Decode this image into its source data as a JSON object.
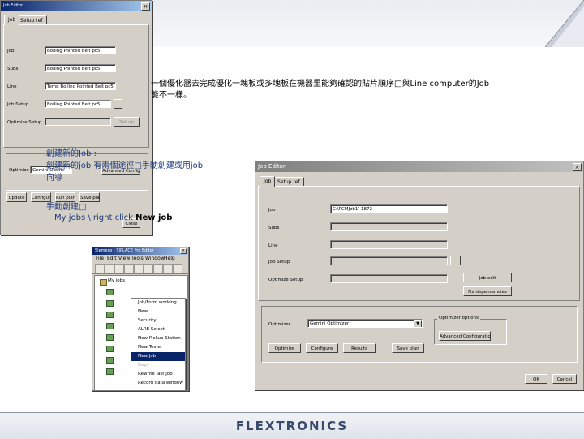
{
  "slide": {
    "intro_line1": "一個優化器去完成優化一塊板或多塊板在機器里能夠確認的貼片順序",
    "intro_line1_tail": "與Line computer的Job",
    "intro_line2": "能不一樣。",
    "heading_create": "創建新的Job :",
    "methods_line": "創建新的job 有兩個途徑",
    "methods_tail": "手動創建或用job",
    "methods_line2": "向導",
    "manual_heading": "手動創建",
    "path_text": "My jobs \\ right click ",
    "path_bold": "New job",
    "logo": "FLEXTRONICS"
  },
  "left_dialog": {
    "title": "Job Editor",
    "tab_job": "Job",
    "tab_setup": "Setup ref",
    "fields": [
      {
        "label": "Job",
        "value": "Boiling Pointed Belt pc5"
      },
      {
        "label": "Subs",
        "value": "Boiling Pointed Belt pc5"
      },
      {
        "label": "Line",
        "value": "Temp Boiling Pointed Belt pc5"
      },
      {
        "label": "Job Setup",
        "value": "Boiling Pointed Belt pc5"
      },
      {
        "label": "Optimize Setup",
        "value": ""
      }
    ],
    "optimizer_label": "Optimize",
    "optimizer_value": "Gemini Optimi",
    "btn_more": "...",
    "btn_side": "Set up",
    "btn_adv": "Advanced Configuration...",
    "buttons": [
      "Update",
      "Configure",
      "Run plan",
      "Save plan",
      "Close"
    ]
  },
  "explorer": {
    "title": "Siemens - SIPLACE Pro Editor",
    "menu": [
      "File",
      "Edit",
      "View",
      "Tools",
      "Window",
      "Help"
    ],
    "tree_root": "My jobs",
    "context_menu": [
      {
        "label": "Job/Form working",
        "state": "normal"
      },
      {
        "label": "New",
        "state": "normal"
      },
      {
        "label": "Security",
        "state": "normal"
      },
      {
        "label": "ALRE Select",
        "state": "normal"
      },
      {
        "label": "New Pickup Station",
        "state": "normal"
      },
      {
        "label": "New Tester",
        "state": "normal"
      },
      {
        "label": "New job",
        "state": "selected"
      },
      {
        "label": "Copy",
        "state": "disabled"
      },
      {
        "label": "Rewrite last job",
        "state": "normal"
      },
      {
        "label": "Record data window",
        "state": "normal"
      }
    ]
  },
  "right_dialog": {
    "title": "Job Editor",
    "tab_job": "Job",
    "tab_setup": "Setup ref",
    "fields": [
      {
        "label": "Job",
        "value": "C:\\PCMJob1\\ 1872"
      },
      {
        "label": "Subs",
        "value": ""
      },
      {
        "label": "Line",
        "value": ""
      },
      {
        "label": "Job Setup",
        "value": ""
      },
      {
        "label": "Optimize Setup",
        "value": ""
      }
    ],
    "btn_dots": "",
    "btn_side1": "Job edit",
    "btn_side2": "Fix dependencies",
    "optimizer_label": "Optimizer",
    "optimizer_value": "Gemini Optimizer",
    "options_label": "Optimizer options",
    "btn_adv": "Advanced Configuration...",
    "buttons": [
      "Optimize",
      "Configure",
      "Results",
      "Save plan"
    ],
    "btn_ok": "OK",
    "btn_cancel": "Cancel"
  }
}
